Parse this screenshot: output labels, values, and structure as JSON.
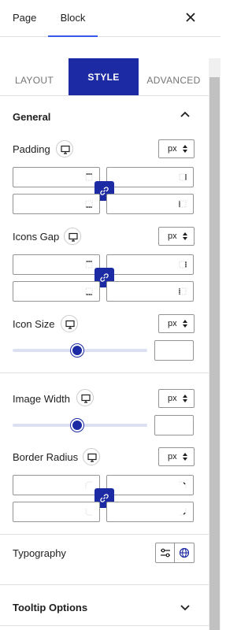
{
  "top_tabs": [
    {
      "label": "Page"
    },
    {
      "label": "Block",
      "active": true
    }
  ],
  "style_tabs": [
    {
      "label": "LAYOUT"
    },
    {
      "label": "STYLE",
      "active": true
    },
    {
      "label": "ADVANCED"
    }
  ],
  "general": {
    "title": "General",
    "padding": {
      "label": "Padding",
      "unit": "px"
    },
    "icons_gap": {
      "label": "Icons Gap",
      "unit": "px"
    },
    "icon_size": {
      "label": "Icon Size",
      "unit": "px",
      "slider_fraction": 0.48
    },
    "image_width": {
      "label": "Image Width",
      "unit": "px",
      "slider_fraction": 0.48
    },
    "border_radius": {
      "label": "Border Radius",
      "unit": "px"
    },
    "typography": {
      "label": "Typography"
    }
  },
  "tooltip_options": {
    "title": "Tooltip Options"
  },
  "colors": {
    "accent": "#1c2aa3",
    "tab_underline": "#3858e9",
    "slider_track": "#dde0f3"
  },
  "icons": [
    "close-icon",
    "chevron-up-icon",
    "chevron-down-icon",
    "desktop-icon",
    "link-icon",
    "sort-arrows-icon",
    "sliders-icon",
    "globe-icon"
  ]
}
